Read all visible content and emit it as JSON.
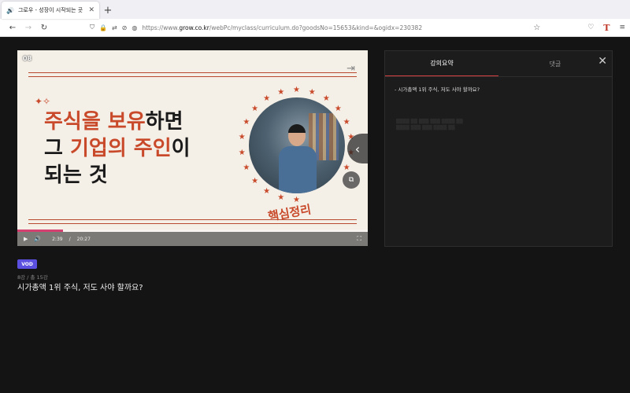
{
  "browser": {
    "tab_title": "그로우 - 성장이 시작되는 곳",
    "url_prefix": "https://www.",
    "url_domain": "grow.co.kr",
    "url_rest": "/webPc/myclass/curriculum.do?goodsNo=15653&kind=&ogidx=230382"
  },
  "player": {
    "slide_number": "08",
    "headline_line1_red": "주식을 보유",
    "headline_line1_black": "하면",
    "headline_line2_black1": "그 ",
    "headline_line2_red": "기업의 주인",
    "headline_line2_black2": "이",
    "headline_line3": "되는 것",
    "core_label": "핵심정리",
    "current_time": "2:39",
    "time_separator": "/",
    "total_time": "20:27",
    "progress": 0.13
  },
  "lesson": {
    "badge": "VOD",
    "count": "8강 / 총 15강",
    "title": "시가총액 1위 주식, 저도 사야 할까요?"
  },
  "panel": {
    "tab_summary": "강의요약",
    "tab_comments": "댓글",
    "summary_item": "- 시가총액 1위 주식, 저도 사야 할까요?"
  },
  "colors": {
    "accent_red": "#c94a2b",
    "badge_purple": "#5b4fe0",
    "progress_pink": "#d64070"
  }
}
